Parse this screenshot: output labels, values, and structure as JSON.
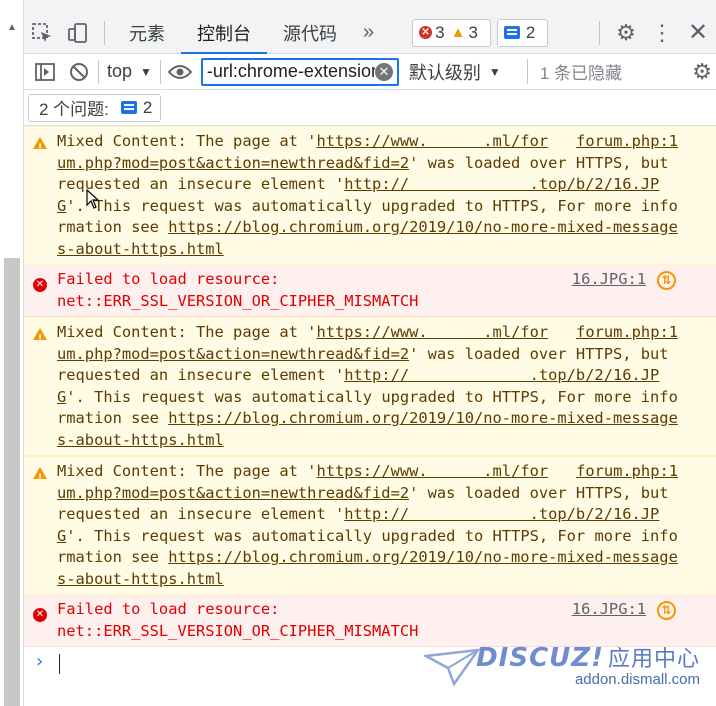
{
  "tabs": [
    {
      "label": "元素"
    },
    {
      "label": "控制台"
    },
    {
      "label": "源代码"
    }
  ],
  "more_tabs_glyph": "»",
  "badges": {
    "errors": "3",
    "warnings": "3",
    "messages": "2"
  },
  "toolbar": {
    "context": "top",
    "filter_value": "-url:chrome-extension",
    "levels": "默认级别",
    "hidden": "1 条已隐藏"
  },
  "issues": {
    "label": "2 个问题:",
    "count": "2"
  },
  "messages": [
    {
      "level": "warning",
      "source": "forum.php:1",
      "parts": [
        {
          "t": "Mixed Content: The page at '"
        },
        {
          "t": "https://www.      .ml/forum.php?mod=post&action=newthread&fid=2",
          "u": true
        },
        {
          "t": "' was loaded over HTTPS, but requested an insecure element '"
        },
        {
          "t": "http://             .top/b/2/16.JPG",
          "u": true
        },
        {
          "t": "'. This request was automatically upgraded to HTTPS, For more information see "
        },
        {
          "t": "https://blog.chromium.org/2019/10/no-more-mixed-messages-about-https.html",
          "u": true
        }
      ]
    },
    {
      "level": "error",
      "source": "16.JPG:1",
      "parts": [
        {
          "t": "Failed to load resource:\nnet::ERR_SSL_VERSION_OR_CIPHER_MISMATCH"
        }
      ]
    },
    {
      "level": "warning",
      "source": "forum.php:1",
      "parts": [
        {
          "t": "Mixed Content: The page at '"
        },
        {
          "t": "https://www.      .ml/forum.php?mod=post&action=newthread&fid=2",
          "u": true
        },
        {
          "t": "' was loaded over HTTPS, but requested an insecure element '"
        },
        {
          "t": "http://             .top/b/2/16.JPG",
          "u": true
        },
        {
          "t": "'. This request was automatically upgraded to HTTPS, For more information see "
        },
        {
          "t": "https://blog.chromium.org/2019/10/no-more-mixed-messages-about-https.html",
          "u": true
        }
      ]
    },
    {
      "level": "warning",
      "source": "forum.php:1",
      "parts": [
        {
          "t": "Mixed Content: The page at '"
        },
        {
          "t": "https://www.      .ml/forum.php?mod=post&action=newthread&fid=2",
          "u": true
        },
        {
          "t": "' was loaded over HTTPS, but requested an insecure element '"
        },
        {
          "t": "http://             .top/b/2/16.JPG",
          "u": true
        },
        {
          "t": "'. This request was automatically upgraded to HTTPS, For more information see "
        },
        {
          "t": "https://blog.chromium.org/2019/10/no-more-mixed-messages-about-https.html",
          "u": true
        }
      ]
    },
    {
      "level": "error",
      "source": "16.JPG:1",
      "parts": [
        {
          "t": "Failed to load resource:\nnet::ERR_SSL_VERSION_OR_CIPHER_MISMATCH"
        }
      ]
    }
  ],
  "watermark": {
    "title": "DISCUZ!",
    "cn": "应用中心",
    "url": "addon.dismall.com"
  },
  "colors": {
    "accent": "#1a73e8",
    "warning_bg": "#fffbe5",
    "error_bg": "#fff0f0",
    "error_text": "#e00000"
  }
}
